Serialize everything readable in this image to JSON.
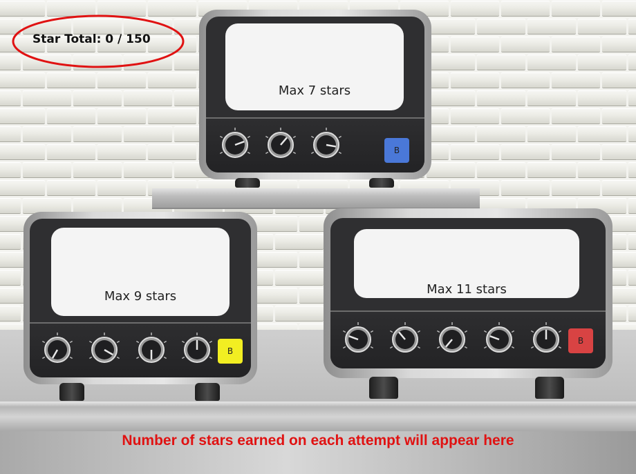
{
  "star_total": {
    "label": "Star Total: 0 / 150"
  },
  "message": "Number of stars earned on each attempt will appear here",
  "machines": [
    {
      "screen_text": "Max 7 stars",
      "button_label": "B",
      "button_color": "#4a78d8",
      "knob_count": 3
    },
    {
      "screen_text": "Max 9 stars",
      "button_label": "B",
      "button_color": "#f2ee22",
      "knob_count": 4
    },
    {
      "screen_text": "Max 11 stars",
      "button_label": "B",
      "button_color": "#d84343",
      "knob_count": 5
    }
  ],
  "colors": {
    "highlight_ellipse": "#e01212",
    "message": "#e01212"
  },
  "icons": {
    "knob": "dial-knob-icon"
  }
}
